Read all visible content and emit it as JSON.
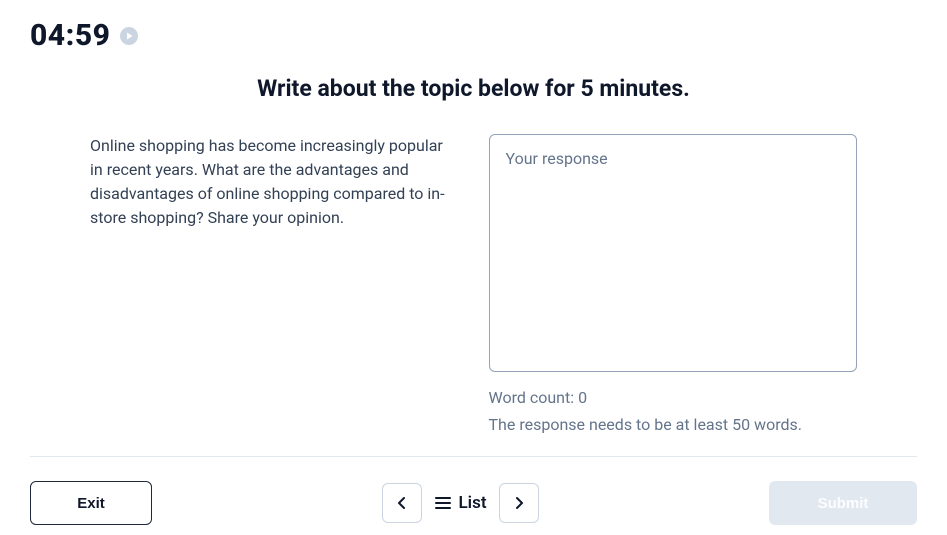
{
  "timer": "04:59",
  "heading": "Write about the topic below for 5 minutes.",
  "prompt": "Online shopping has become increasingly popular in recent years. What are the advantages and disadvantages of online shopping compared to in-store shopping? Share your opinion.",
  "response": {
    "placeholder": "Your response",
    "value": ""
  },
  "word_count_label": "Word count: 0",
  "word_count_hint": "The response needs to be at least 50 words.",
  "footer": {
    "exit": "Exit",
    "list": "List",
    "submit": "Submit"
  }
}
